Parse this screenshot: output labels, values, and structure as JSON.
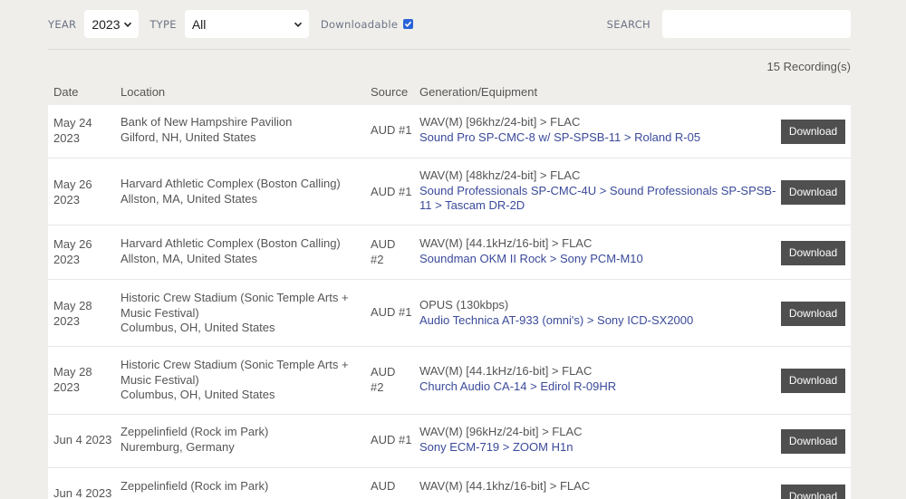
{
  "filters": {
    "year_label": "YEAR",
    "year_value": "2023",
    "type_label": "TYPE",
    "type_value": "All",
    "downloadable_label": "Downloadable",
    "downloadable_checked": true,
    "search_label": "SEARCH",
    "search_value": ""
  },
  "count_text": "15 Recording(s)",
  "columns": {
    "date": "Date",
    "location": "Location",
    "source": "Source",
    "generation": "Generation/Equipment"
  },
  "download_label": "Download",
  "rows": [
    {
      "date1": "May 24",
      "date2": "2023",
      "loc1": "Bank of New Hampshire Pavilion",
      "loc2": "Gilford, NH, United States",
      "src1": "AUD #1",
      "src2": "",
      "gen": "WAV(M) [96khz/24-bit] > FLAC",
      "eq": "Sound Pro SP-CMC-8 w/ SP-SPSB-11 > Roland R-05"
    },
    {
      "date1": "May 26",
      "date2": "2023",
      "loc1": "Harvard Athletic Complex (Boston Calling)",
      "loc2": "Allston, MA, United States",
      "src1": "AUD #1",
      "src2": "",
      "gen": "WAV(M) [48khz/24-bit] > FLAC",
      "eq": "Sound Professionals SP-CMC-4U > Sound Professionals SP-SPSB-11 > Tascam DR-2D"
    },
    {
      "date1": "May 26",
      "date2": "2023",
      "loc1": "Harvard Athletic Complex (Boston Calling)",
      "loc2": "Allston, MA, United States",
      "src1": "AUD",
      "src2": "#2",
      "gen": "WAV(M) [44.1kHz/16-bit] > FLAC",
      "eq": "Soundman OKM II Rock > Sony PCM-M10"
    },
    {
      "date1": "May 28",
      "date2": "2023",
      "loc1": "Historic Crew Stadium (Sonic Temple Arts + Music Festival)",
      "loc2": "Columbus, OH, United States",
      "src1": "AUD #1",
      "src2": "",
      "gen": "OPUS (130kbps)",
      "eq": "Audio Technica AT-933 (omni's) > Sony ICD-SX2000"
    },
    {
      "date1": "May 28",
      "date2": "2023",
      "loc1": "Historic Crew Stadium (Sonic Temple Arts + Music Festival)",
      "loc2": "Columbus, OH, United States",
      "src1": "AUD",
      "src2": "#2",
      "gen": "WAV(M) [44.1kHz/16-bit] > FLAC",
      "eq": "Church Audio CA-14 > Edirol R-09HR"
    },
    {
      "date1": "Jun 4 2023",
      "date2": "",
      "loc1": "Zeppelinfield (Rock im Park)",
      "loc2": "Nuremburg, Germany",
      "src1": "AUD #1",
      "src2": "",
      "gen": "WAV(M) [96kHz/24-bit] > FLAC",
      "eq": "Sony ECM-719 > ZOOM H1n"
    },
    {
      "date1": "Jun 4 2023",
      "date2": "",
      "loc1": "Zeppelinfield (Rock im Park)",
      "loc2": "",
      "src1": "AUD",
      "src2": "",
      "gen": "WAV(M) [44.1khz/16-bit] > FLAC",
      "eq": ""
    }
  ]
}
